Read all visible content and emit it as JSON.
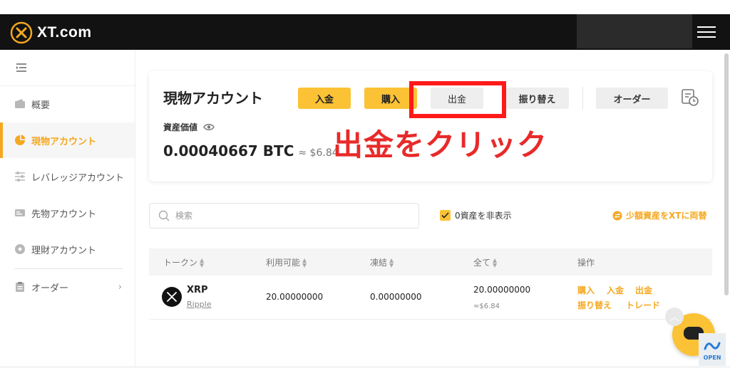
{
  "header": {
    "brand": "XT.COM",
    "brand_text": "XT.com"
  },
  "sidebar": {
    "items": [
      {
        "label": "概要",
        "icon": "wallet-icon"
      },
      {
        "label": "現物アカウント",
        "icon": "pie-chart-icon",
        "active": true
      },
      {
        "label": "レバレッジアカウント",
        "icon": "sliders-icon"
      },
      {
        "label": "先物アカウント",
        "icon": "card-icon"
      },
      {
        "label": "理財アカウント",
        "icon": "tag-icon"
      },
      {
        "label": "オーダー",
        "icon": "clipboard-icon"
      }
    ]
  },
  "account": {
    "title": "現物アカウント",
    "buttons": {
      "deposit": "入金",
      "buy": "購入",
      "withdraw": "出金",
      "transfer": "振り替え",
      "order": "オーダー"
    },
    "asset_label": "資産価値",
    "asset_btc": "0.00040667 BTC",
    "asset_usd": "≈ $6.84"
  },
  "annotation": {
    "text": "出金をクリック",
    "color": "#e82a2a"
  },
  "search": {
    "placeholder": "検索"
  },
  "filters": {
    "hide_zero": "0資産を非表示",
    "convert_small": "少額資産をXTに両替"
  },
  "table": {
    "headers": [
      "トークン",
      "利用可能",
      "凍結",
      "全て",
      "操作"
    ],
    "rows": [
      {
        "symbol": "XRP",
        "name": "Ripple",
        "available": "20.00000000",
        "frozen": "0.00000000",
        "total": "20.00000000",
        "total_usd": "≈$6.84",
        "actions": [
          "購入",
          "入金",
          "出金",
          "振り替え",
          "トレード"
        ]
      }
    ]
  },
  "widgets": {
    "open_badge": "OPEN"
  },
  "colors": {
    "accent": "#fcc235",
    "accent_text": "#f4a820",
    "topbar": "#121212",
    "highlight": "#ff1a1a"
  }
}
